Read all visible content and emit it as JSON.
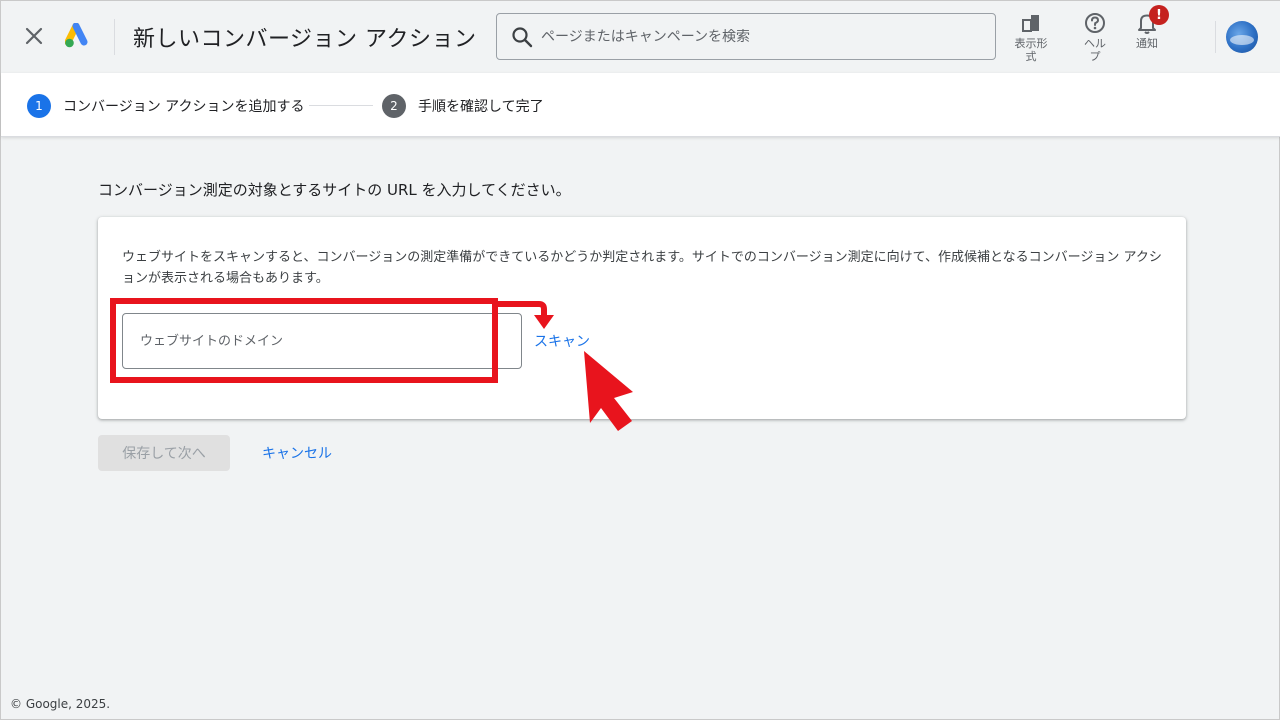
{
  "header": {
    "title": "新しいコンバージョン アクション",
    "search_placeholder": "ページまたはキャンペーンを検索",
    "tools": [
      {
        "label": "表示形\n式",
        "icon": "display-format-icon"
      },
      {
        "label": "ヘル\nプ",
        "icon": "help-icon"
      },
      {
        "label": "通知",
        "icon": "bell-icon"
      }
    ],
    "notification_badge": "!"
  },
  "stepper": {
    "steps": [
      {
        "number": "1",
        "label": "コンバージョン アクションを追加する",
        "active": true
      },
      {
        "number": "2",
        "label": "手順を確認して完了",
        "active": false
      }
    ]
  },
  "main": {
    "instruction": "コンバージョン測定の対象とするサイトの URL を入力してください。",
    "card": {
      "description": "ウェブサイトをスキャンすると、コンバージョンの測定準備ができているかどうか判定されます。サイトでのコンバージョン測定に向けて、作成候補となるコンバージョン アクションが表示される場合もあります。",
      "domain_placeholder": "ウェブサイトのドメイン",
      "domain_value": "",
      "scan_label": "スキャン"
    },
    "save_label": "保存して次へ",
    "cancel_label": "キャンセル"
  },
  "footer": "© Google, 2025.",
  "colors": {
    "accent": "#1a73e8",
    "annotation": "#e8141d",
    "badge": "#c5221f",
    "inactive_step": "#5f6368"
  }
}
